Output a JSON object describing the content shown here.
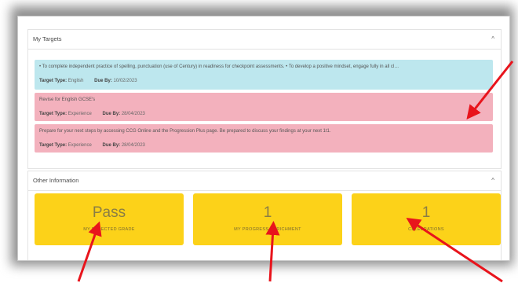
{
  "targets_panel": {
    "title": "My Targets",
    "caret": "^",
    "items": [
      {
        "description": "• To complete independent practice of spelling, punctuation (use of Century) in readiness for checkpoint assessments. • To develop a positive mindset, engage fully in all cl…",
        "type_label": "Target Type:",
        "type_value": "English",
        "due_label": "Due By:",
        "due_value": "10/02/2023"
      },
      {
        "description": "Revise for English GCSE's",
        "type_label": "Target Type:",
        "type_value": "Experience",
        "due_label": "Due By:",
        "due_value": "28/04/2023"
      },
      {
        "description": "Prepare for your next steps by accessing CCG Online and the Progression Plus page. Be prepared to discuss your findings at your next 1t1.",
        "type_label": "Target Type:",
        "type_value": "Experience",
        "due_label": "Due By:",
        "due_value": "28/04/2023"
      }
    ]
  },
  "other_panel": {
    "title": "Other Information",
    "caret": "^",
    "cards": [
      {
        "value": "Pass",
        "label": "My Expected Grade"
      },
      {
        "value": "1",
        "label": "My Progress Enrichment"
      },
      {
        "value": "1",
        "label": "Celebrations"
      }
    ]
  },
  "colors": {
    "info": "#bde7ee",
    "alert": "#f3b1bd",
    "card": "#fcd219",
    "arrow": "#e8141c"
  }
}
